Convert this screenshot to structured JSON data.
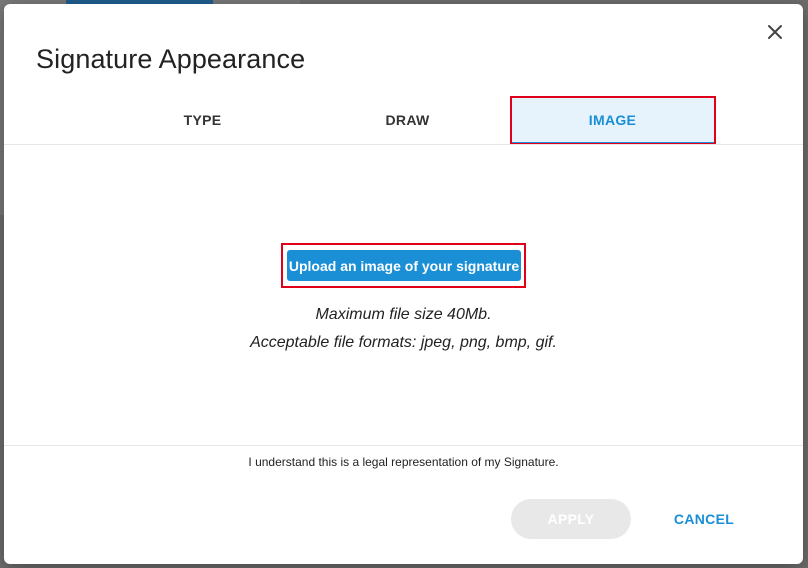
{
  "dialog": {
    "title": "Signature Appearance",
    "close_icon": "close-icon"
  },
  "tabs": [
    {
      "label": "TYPE",
      "active": false
    },
    {
      "label": "DRAW",
      "active": false
    },
    {
      "label": "IMAGE",
      "active": true
    }
  ],
  "upload": {
    "button_label": "Upload an image of your signature",
    "max_size_text": "Maximum file size 40Mb.",
    "formats_text": "Acceptable file formats: jpeg, png, bmp, gif."
  },
  "legal": {
    "text": "I understand this is a legal representation of my Signature."
  },
  "footer": {
    "apply_label": "APPLY",
    "apply_enabled": false,
    "cancel_label": "CANCEL"
  },
  "colors": {
    "accent": "#1a8fd6",
    "highlight": "#e0001a",
    "disabled": "#e8e8e8"
  }
}
